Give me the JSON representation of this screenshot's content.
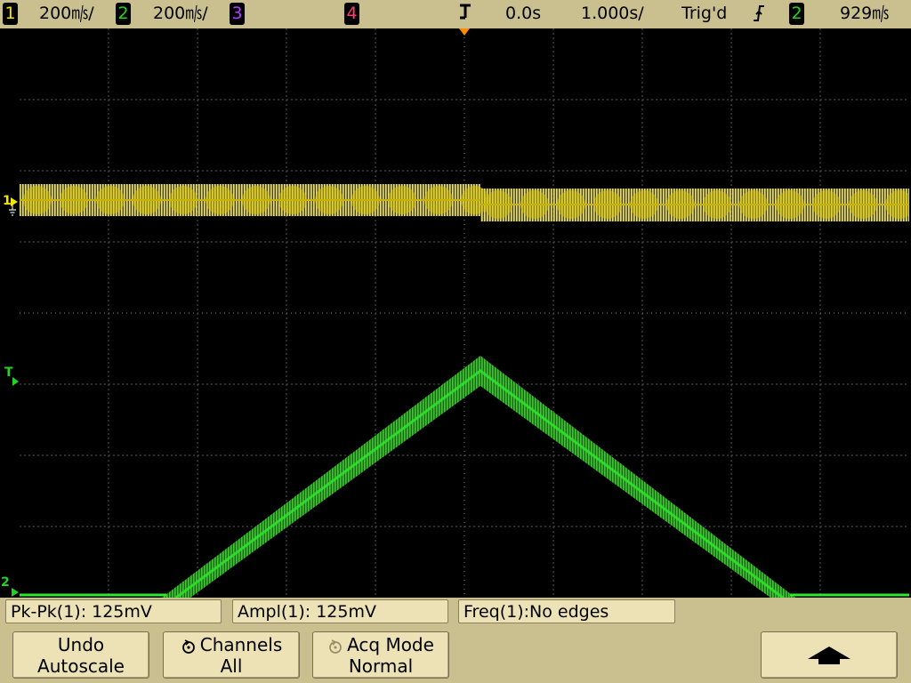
{
  "status_bar": {
    "ch1": {
      "number": "1",
      "scale": "200㎧/",
      "color": "#f5e400"
    },
    "ch2": {
      "number": "2",
      "scale": "200㎧/",
      "color": "#23d323"
    },
    "ch3": {
      "number": "3",
      "color": "#b040ff"
    },
    "ch4": {
      "number": "4",
      "color": "#ff3c78"
    },
    "delay": "0.0s",
    "timebase": "1.000s/",
    "trigger_status": "Trig'd",
    "trigger_source": "2",
    "trigger_level": "929㎧",
    "trigger_slope_icon": "rising-edge-icon",
    "delay_icon": "delay-marker-icon"
  },
  "markers": {
    "ch1_marker": "1",
    "trigger_marker": "T",
    "ch2_marker": "2"
  },
  "measurements": [
    {
      "label": "Pk-Pk(1): 125mV"
    },
    {
      "label": "Ampl(1): 125mV"
    },
    {
      "label": "Freq(1):No edges"
    }
  ],
  "softkeys": {
    "undo": {
      "line1": "Undo",
      "line2": "Autoscale"
    },
    "channels": {
      "line1": "Channels",
      "line2": "All",
      "icon": "rotate-knob-icon"
    },
    "acq_mode": {
      "line1": "Acq Mode",
      "line2": "Normal",
      "icon": "rotate-knob-icon"
    },
    "up": {
      "icon": "up-arrow-icon"
    }
  },
  "colors": {
    "ch1": "#f5e400",
    "ch2": "#23d323",
    "grid": "#555555",
    "trigger": "#ff8c00"
  }
}
